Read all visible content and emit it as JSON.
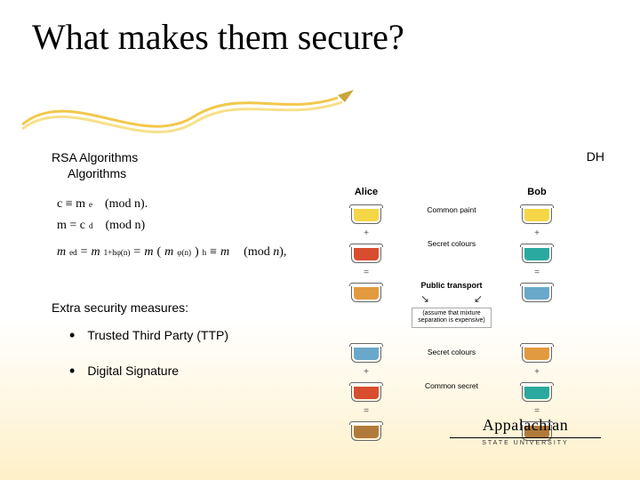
{
  "title": "What makes them secure?",
  "rsa": {
    "line1": "RSA Algorithms",
    "line2": "Algorithms"
  },
  "dh_label": "DH",
  "formulas": {
    "f1_left": "c ≡ m",
    "f1_sup": "e",
    "f1_right": "(mod n).",
    "f2_left": "m = c",
    "f2_sup": "d",
    "f2_right": "(mod n)",
    "f3": "m^{ed} = m^{1+hφ(n)} = m(m^{φ(n)})^{h} ≡ m   (mod n),"
  },
  "extra_heading": "Extra security measures:",
  "bullets": {
    "b1": "Trusted Third Party (TTP)",
    "b2": "Digital Signature"
  },
  "dh_diagram": {
    "alice": "Alice",
    "bob": "Bob",
    "common_paint": "Common paint",
    "secret_colours": "Secret colours",
    "public_transport": "Public transport",
    "note": "(assume that mixture separation is expensive)",
    "secret_colours2": "Secret colours",
    "common_secret": "Common secret",
    "colors": {
      "common": "#f4d646",
      "alice_secret": "#d84c2f",
      "bob_secret": "#2aa9a0",
      "alice_mix": "#e29a3e",
      "bob_mix": "#6aa8c9",
      "final": "#b07a3a"
    }
  },
  "logo": {
    "name_main": "Appalachian",
    "sub": "STATE UNIVERSITY"
  }
}
